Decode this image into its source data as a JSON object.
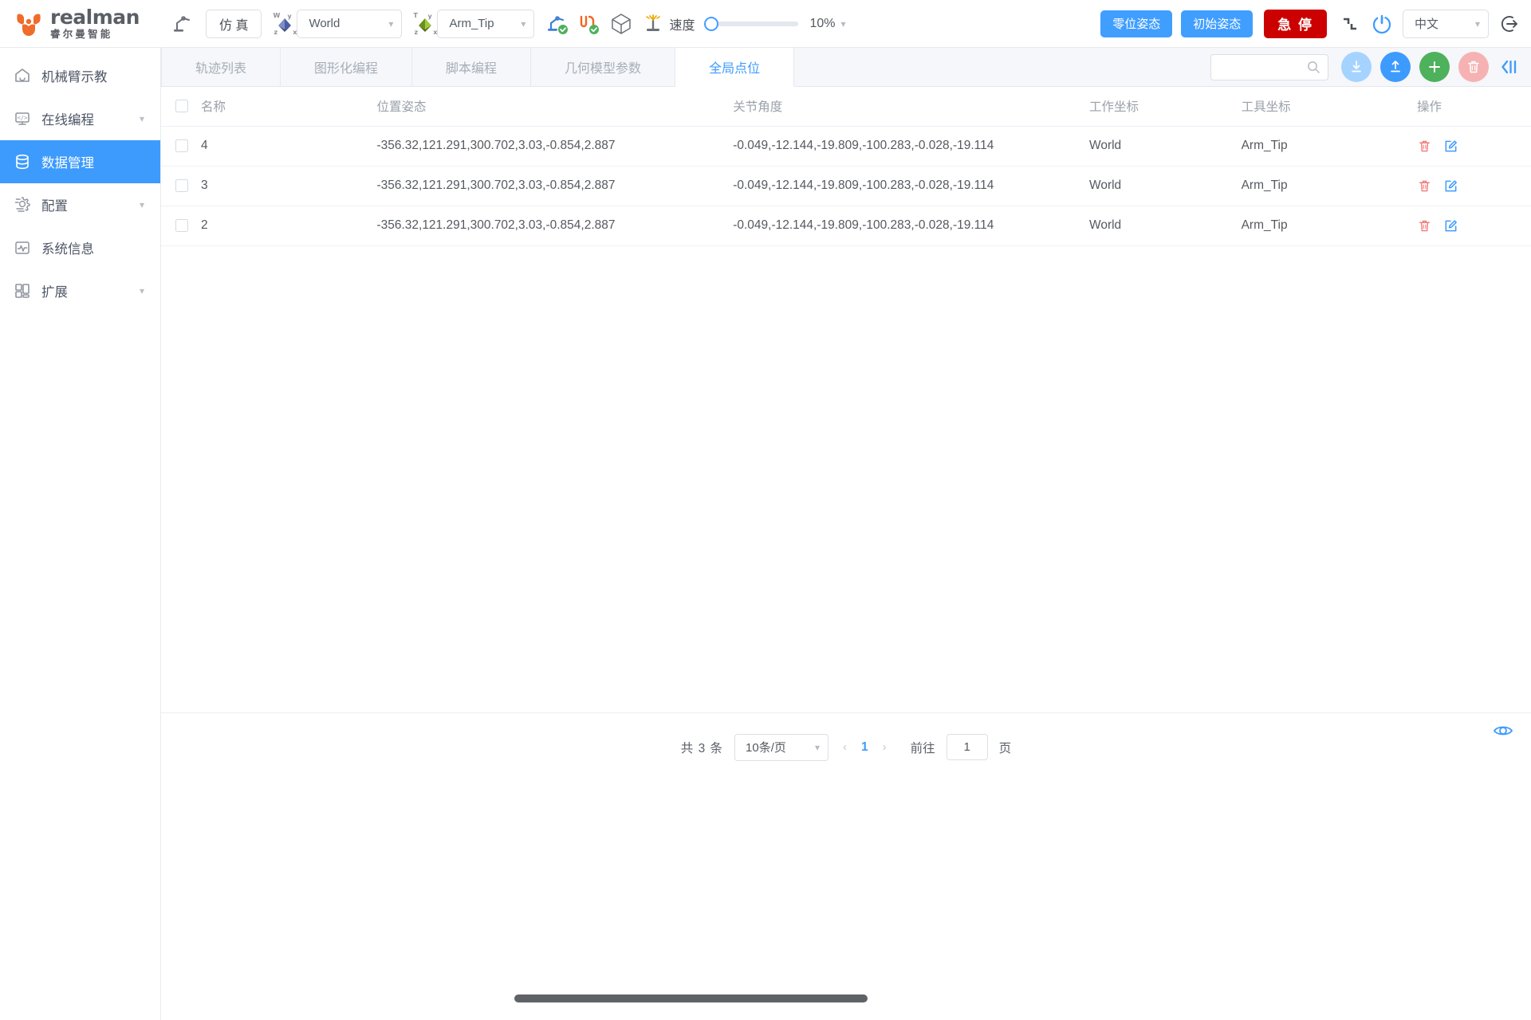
{
  "topbar": {
    "logo_en": "realman",
    "logo_cn": "睿尔曼智能",
    "teach_icon": "robot-arm-icon",
    "sim_label": "仿 真",
    "world_axis_icon": "world-axis-icon",
    "world_value": "World",
    "tool_axis_icon": "tool-axis-icon",
    "tool_value": "Arm_Tip",
    "arm_status_icon": "arm-connected-icon",
    "gripper_status_icon": "gripper-connected-icon",
    "model_icon": "cube-model-icon",
    "collision_icon": "collision-detect-icon",
    "speed_label": "速度",
    "speed_value": "10%",
    "zero_pose_label": "零位姿态",
    "init_pose_label": "初始姿态",
    "estop_label": "急 停",
    "drag_icon": "drag-teach-icon",
    "power_icon": "power-icon",
    "lang_value": "中文",
    "logout_icon": "logout-icon"
  },
  "sidebar": {
    "items": [
      {
        "label": "机械臂示教",
        "icon": "home-icon",
        "active": false,
        "expandable": false
      },
      {
        "label": "在线编程",
        "icon": "code-icon",
        "active": false,
        "expandable": true
      },
      {
        "label": "数据管理",
        "icon": "database-icon",
        "active": true,
        "expandable": false
      },
      {
        "label": "配置",
        "icon": "gear-icon",
        "active": false,
        "expandable": true
      },
      {
        "label": "系统信息",
        "icon": "monitor-wave-icon",
        "active": false,
        "expandable": false
      },
      {
        "label": "扩展",
        "icon": "grid-blocks-icon",
        "active": false,
        "expandable": true
      }
    ]
  },
  "tabs": [
    {
      "label": "轨迹列表",
      "active": false
    },
    {
      "label": "图形化编程",
      "active": false
    },
    {
      "label": "脚本编程",
      "active": false
    },
    {
      "label": "几何模型参数",
      "active": false
    },
    {
      "label": "全局点位",
      "active": true
    }
  ],
  "toolbar": {
    "search_value": "",
    "search_placeholder": "",
    "search_icon": "search-icon",
    "download_icon": "download-icon",
    "upload_icon": "upload-icon",
    "add_icon": "plus-icon",
    "delete_icon": "trash-icon",
    "collapse_icon": "collapse-panel-icon"
  },
  "table": {
    "columns": [
      "名称",
      "位置姿态",
      "关节角度",
      "工作坐标",
      "工具坐标",
      "操作"
    ],
    "rows": [
      {
        "name": "4",
        "pose": "-356.32,121.291,300.702,3.03,-0.854,2.887",
        "joints": "-0.049,-12.144,-19.809,-100.283,-0.028,-19.114",
        "work": "World",
        "tool": "Arm_Tip"
      },
      {
        "name": "3",
        "pose": "-356.32,121.291,300.702,3.03,-0.854,2.887",
        "joints": "-0.049,-12.144,-19.809,-100.283,-0.028,-19.114",
        "work": "World",
        "tool": "Arm_Tip"
      },
      {
        "name": "2",
        "pose": "-356.32,121.291,300.702,3.03,-0.854,2.887",
        "joints": "-0.049,-12.144,-19.809,-100.283,-0.028,-19.114",
        "work": "World",
        "tool": "Arm_Tip"
      }
    ],
    "row_delete_icon": "trash-icon",
    "row_edit_icon": "edit-icon"
  },
  "pagination": {
    "total_text": "共 3 条",
    "page_size": "10条/页",
    "prev_icon": "chevron-left-icon",
    "current_page": "1",
    "next_icon": "chevron-right-icon",
    "goto_label": "前往",
    "goto_value": "1",
    "page_unit": "页",
    "eye_icon": "eye-icon"
  },
  "colors": {
    "accent": "#3d9bfd",
    "danger": "#cc0000",
    "success": "#4eb15c",
    "logo_orange": "#ef6c2a"
  }
}
